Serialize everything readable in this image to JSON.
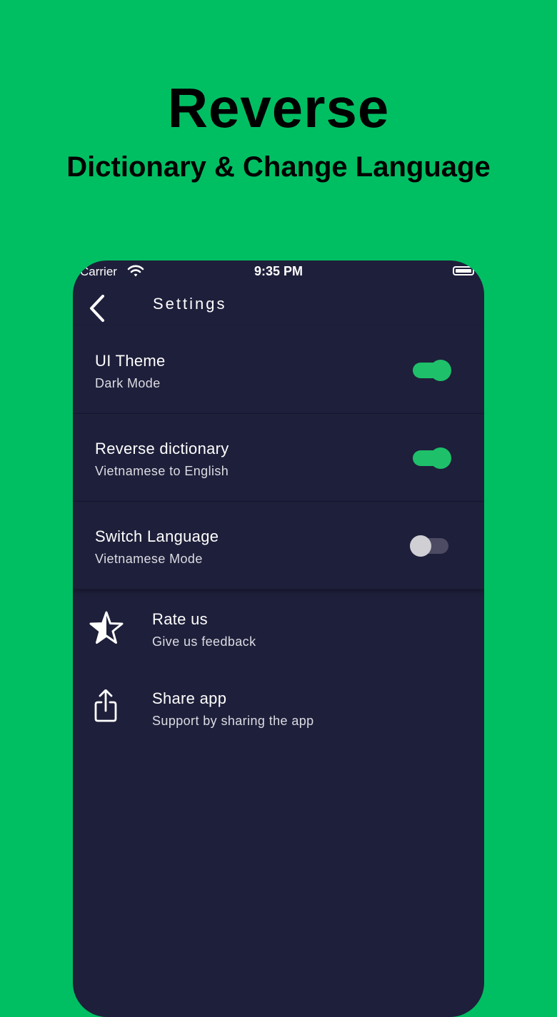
{
  "banner": {
    "title": "Reverse",
    "subtitle": "Dictionary & Change Language"
  },
  "status_bar": {
    "carrier": "Carrier",
    "time": "9:35 PM",
    "icons": [
      "wifi-icon",
      "battery-icon"
    ]
  },
  "nav": {
    "title": "Settings",
    "back_icon": "chevron-left-icon"
  },
  "settings": [
    {
      "title": "UI Theme",
      "subtitle": "Dark Mode",
      "enabled": true
    },
    {
      "title": "Reverse dictionary",
      "subtitle": "Vietnamese to English",
      "enabled": true
    },
    {
      "title": "Switch Language",
      "subtitle": "Vietnamese Mode",
      "enabled": false
    }
  ],
  "links": [
    {
      "icon": "star-icon",
      "title": "Rate us",
      "subtitle": "Give us feedback"
    },
    {
      "icon": "share-icon",
      "title": "Share app",
      "subtitle": "Support by sharing the app"
    }
  ],
  "colors": {
    "background": "#00bf63",
    "phone_background": "#1e1f3a",
    "toggle_on": "#1ec06a",
    "toggle_off_track": "#4d4b63",
    "toggle_off_knob": "#cfcfd4"
  }
}
